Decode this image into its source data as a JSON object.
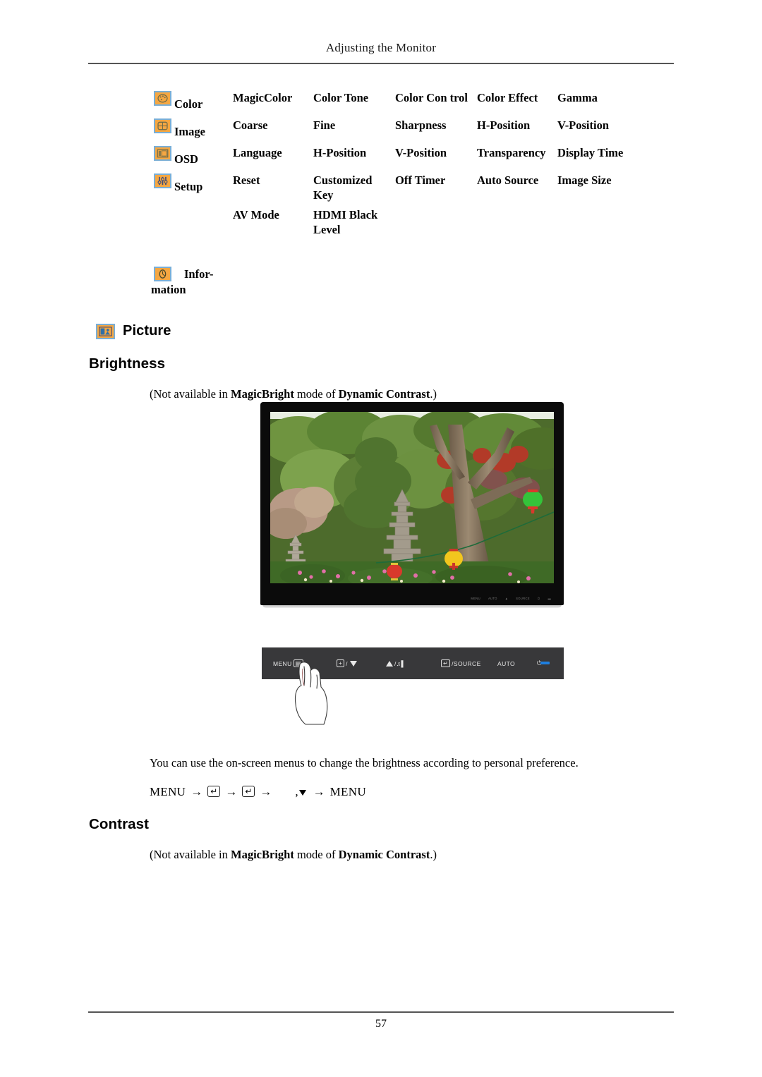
{
  "page": {
    "running_head": "Adjusting the Monitor",
    "page_number": "57"
  },
  "menu_table": {
    "rows": [
      {
        "icon": "color-palette-icon",
        "category": "Color",
        "items": [
          "MagicColor",
          "Color Tone",
          "Color Con-trol",
          "Color Effect",
          "Gamma"
        ],
        "items_display": [
          "MagicColor",
          "Color Tone",
          "Color Con­ trol",
          "Color Effect",
          "Gamma"
        ]
      },
      {
        "icon": "image-frame-icon",
        "category": "Image",
        "items": [
          "Coarse",
          "Fine",
          "Sharpness",
          "H-Position",
          "V-Position"
        ],
        "items_display": [
          "Coarse",
          "Fine",
          "Sharpness",
          "H-Position",
          "V-Position"
        ]
      },
      {
        "icon": "osd-window-icon",
        "category": "OSD",
        "items": [
          "Language",
          "H-Position",
          "V-Position",
          "Transparency",
          "Display Time"
        ],
        "items_display": [
          "Language",
          "H-Position",
          "V-Position",
          "Transparen­cy",
          "Display Time"
        ]
      },
      {
        "icon": "setup-sliders-icon",
        "category": "Setup",
        "items": [
          "Reset",
          "Customized Key",
          "Off Timer",
          "Auto Source",
          "Image Size"
        ],
        "items_display": [
          "Reset",
          "Customized Key",
          "Off Timer",
          "Auto Source",
          "Image Size"
        ]
      }
    ],
    "sub_row": {
      "items": [
        "AV Mode",
        "HDMI Black Level",
        "",
        "",
        ""
      ]
    },
    "information": {
      "icon": "clock-information-icon",
      "label_line1": "Infor-",
      "label_line2": "mation"
    }
  },
  "picture_section": {
    "icon": "picture-icon",
    "title": "Picture",
    "brightness": {
      "heading": "Brightness",
      "note_prefix": "(Not available in ",
      "note_bold1": "MagicBright",
      "note_mid": " mode of ",
      "note_bold2": "Dynamic Contrast",
      "note_suffix": ".)",
      "description": "You can use the on-screen menus to change the brightness according to personal preference.",
      "menu_sequence": {
        "start": "MENU",
        "arrow": "→",
        "enter_key": "↵",
        "comma": ",",
        "down_arrow": "▼",
        "end": "MENU"
      }
    },
    "contrast": {
      "heading": "Contrast",
      "note_prefix": "(Not available in ",
      "note_bold1": "MagicBright",
      "note_mid": " mode of ",
      "note_bold2": "Dynamic Contrast",
      "note_suffix": ".)"
    }
  },
  "monitor_figure": {
    "alt": "monitor displaying a garden photo with stone pagodas and lanterns",
    "bezel_labels": [
      "MENU",
      "AUTO",
      "▲",
      "SOURCE",
      "⏻",
      "▬"
    ]
  },
  "control_panel": {
    "buttons": [
      {
        "name": "menu-button",
        "label": "MENU"
      },
      {
        "name": "plus-down-button",
        "label": "/"
      },
      {
        "name": "up-volume-button",
        "label": "/"
      },
      {
        "name": "enter-source-button",
        "label": "/SOURCE"
      },
      {
        "name": "auto-button",
        "label": "AUTO"
      },
      {
        "name": "power-button",
        "label": "⏻"
      }
    ],
    "led_color": "#1e7fe0"
  },
  "colors": {
    "icon_fill": "#f5a742",
    "icon_border": "#79aed6",
    "panel_bg": "#38383a",
    "bezel": "#0b0b0b",
    "rule": "#555555"
  }
}
